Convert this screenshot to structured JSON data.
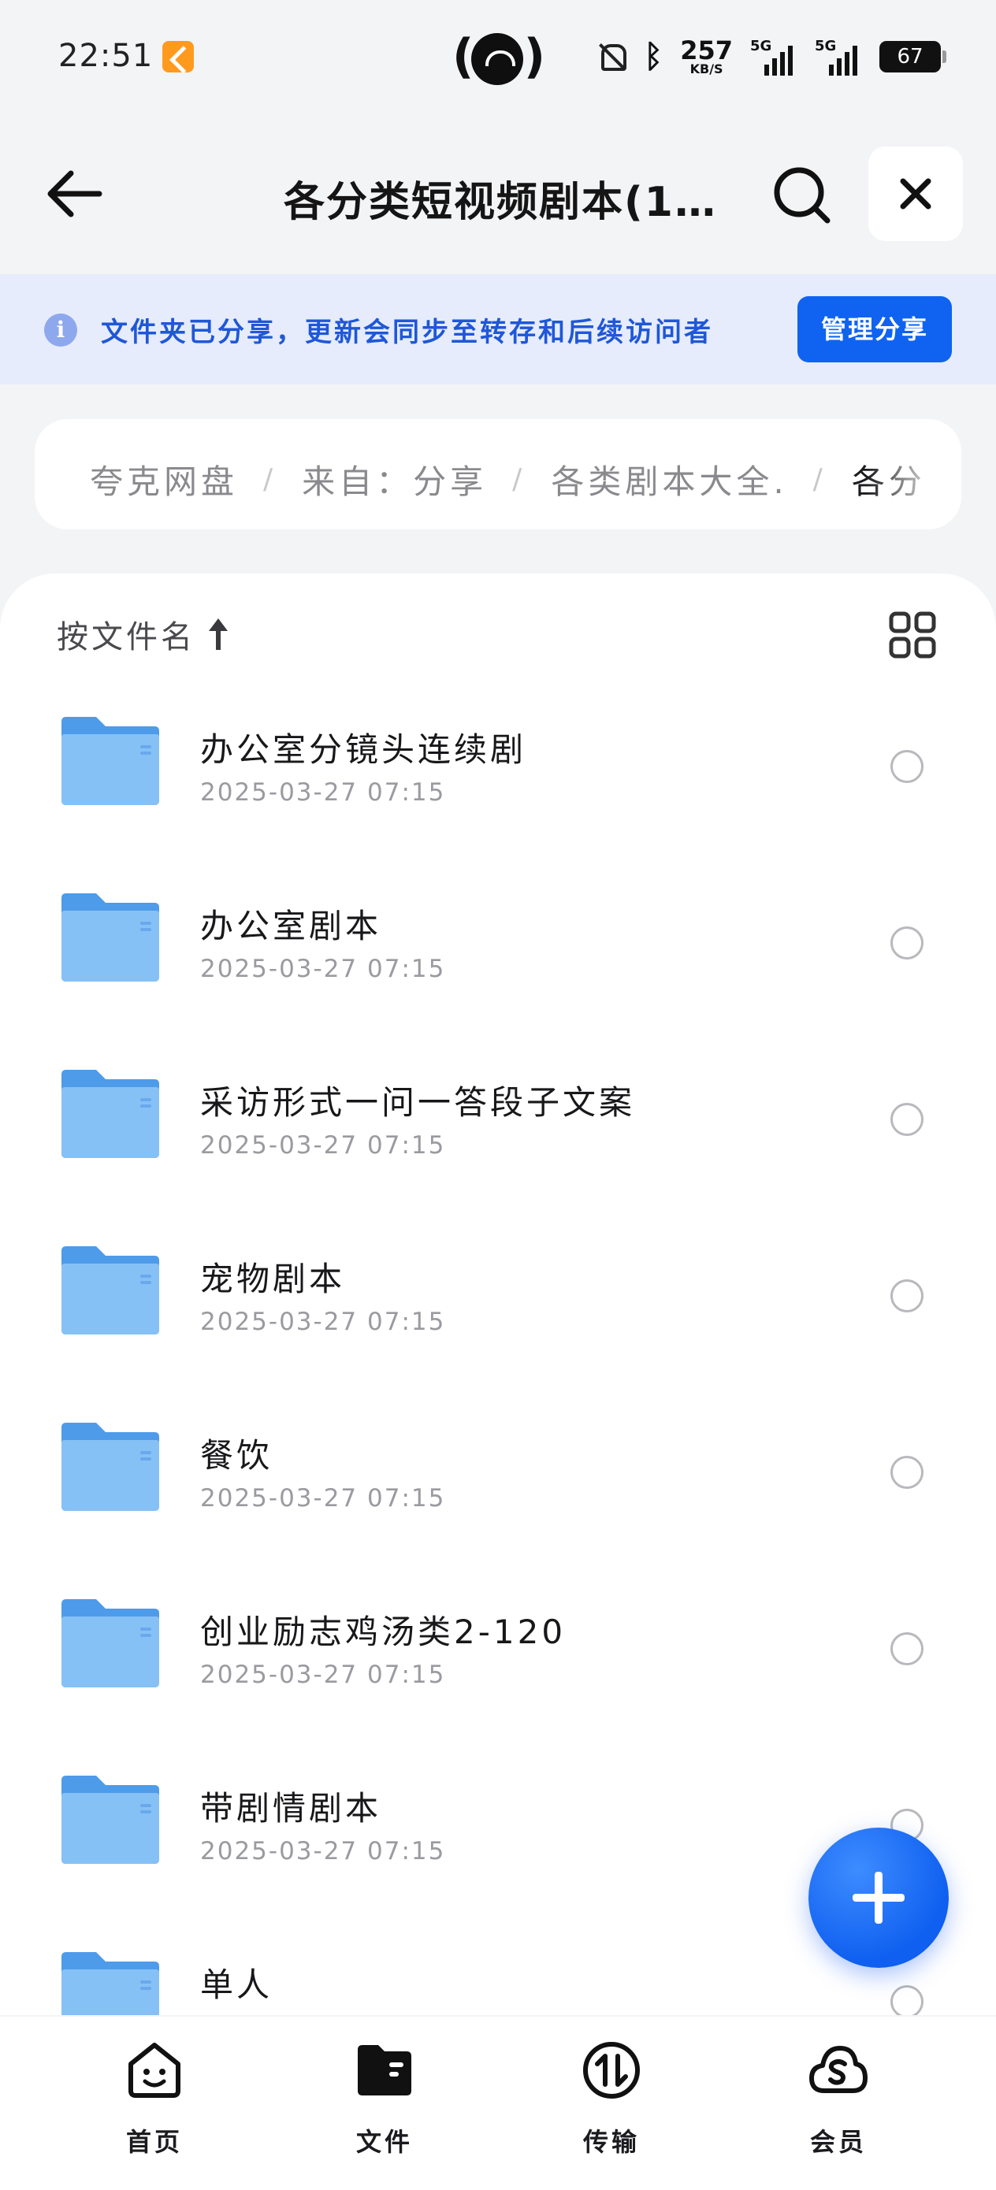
{
  "status_bar": {
    "time": "22:51",
    "net_speed_value": "257",
    "net_speed_unit": "KB/S",
    "signal_1_label": "5G",
    "signal_2_label": "5G",
    "battery": "67"
  },
  "header": {
    "title": "各分类短视频剧本(1...",
    "icons": {
      "back": "back-arrow-icon",
      "search": "search-icon",
      "close": "close-icon"
    }
  },
  "share_banner": {
    "text": "文件夹已分享，更新会同步至转存和后续访问者",
    "button_label": "管理分享"
  },
  "breadcrumb": {
    "items": [
      "夸克网盘",
      "来自：分享",
      "各类剧本大全.",
      "各分"
    ],
    "separator": "/"
  },
  "toolbar": {
    "sort_label": "按文件名"
  },
  "files": [
    {
      "name": "办公室分镜头连续剧",
      "date": "2025-03-27 07:15"
    },
    {
      "name": "办公室剧本",
      "date": "2025-03-27 07:15"
    },
    {
      "name": "采访形式一问一答段子文案",
      "date": "2025-03-27 07:15"
    },
    {
      "name": "宠物剧本",
      "date": "2025-03-27 07:15"
    },
    {
      "name": "餐饮",
      "date": "2025-03-27 07:15"
    },
    {
      "name": "创业励志鸡汤类2-120",
      "date": "2025-03-27 07:15"
    },
    {
      "name": "带剧情剧本",
      "date": "2025-03-27 07:15"
    },
    {
      "name": "单人",
      "date": ""
    }
  ],
  "bottom_nav": {
    "items": [
      {
        "label": "首页",
        "icon": "home-face-icon"
      },
      {
        "label": "文件",
        "icon": "folder-icon"
      },
      {
        "label": "传输",
        "icon": "transfer-icon"
      },
      {
        "label": "会员",
        "icon": "vip-cloud-icon"
      }
    ],
    "active_index": 1
  },
  "colors": {
    "accent": "#0f63f0",
    "banner_bg": "#e6ecfb",
    "banner_text": "#1f57d8",
    "folder": "#7ab8f5"
  }
}
